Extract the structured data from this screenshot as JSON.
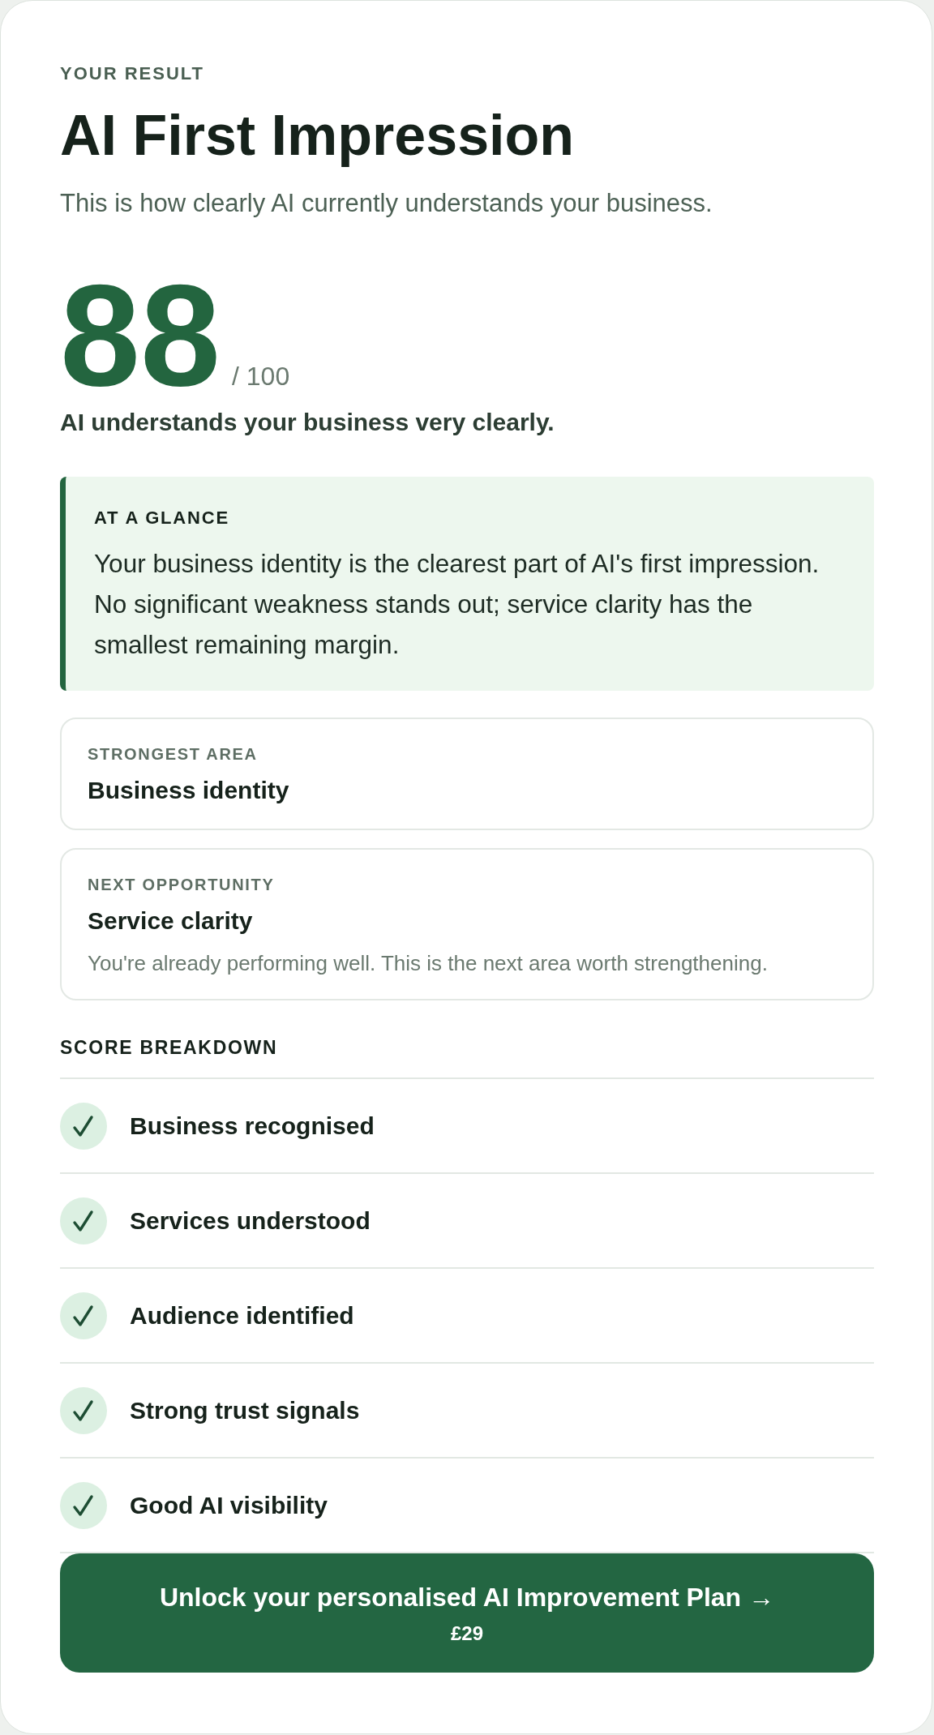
{
  "eyebrow": "YOUR RESULT",
  "title": "AI First Impression",
  "subtitle": "This is how clearly AI currently understands your business.",
  "score": {
    "value": "88",
    "out_of": "/ 100",
    "verdict": "AI understands your business very clearly."
  },
  "at_a_glance": {
    "title": "AT A GLANCE",
    "text": "Your business identity is the clearest part of AI's first impression. No significant weakness stands out; service clarity has the smallest remaining margin."
  },
  "highlights": [
    {
      "label": "STRONGEST AREA",
      "value": "Business identity"
    },
    {
      "label": "NEXT OPPORTUNITY",
      "value": "Service clarity",
      "note": "You're already performing well. This is the next area worth strengthening."
    }
  ],
  "score_breakdown": {
    "title": "SCORE BREAKDOWN",
    "items": [
      {
        "label": "Business recognised",
        "checked": true
      },
      {
        "label": "Services understood",
        "checked": true
      },
      {
        "label": "Audience identified",
        "checked": true
      },
      {
        "label": "Strong trust signals",
        "checked": true
      },
      {
        "label": "Good AI visibility",
        "checked": true
      }
    ]
  },
  "cta_button": {
    "label": "Unlock your personalised AI Improvement Plan →",
    "price": "£29"
  }
}
